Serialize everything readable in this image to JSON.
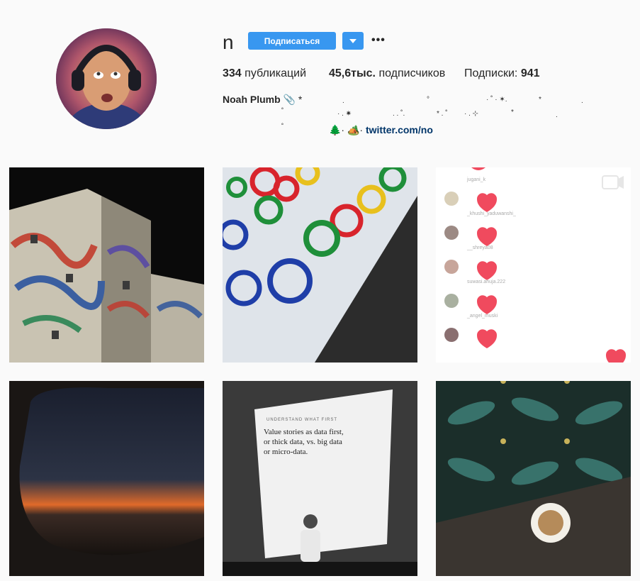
{
  "profile": {
    "username": "n",
    "follow_label": "Подписаться",
    "more_label": "•••",
    "posts_count": "334",
    "posts_label": "публикаций",
    "followers_count": "45,6тыс.",
    "followers_label": "подписчиков",
    "following_label": "Подписки:",
    "following_count": "941",
    "name": "Noah Plumb",
    "name_emoji": "📎 *",
    "bio_line1_stars": [
      ".",
      "°",
      "· ˚ · ✶.",
      "*",
      "."
    ],
    "bio_line2_stars": [
      "˚",
      "· . ✷",
      ". . ˚.",
      "* . ˚",
      "· . ⊹",
      "*",
      "."
    ],
    "bio_line3_star": "˚",
    "bio_emoji": "🌲· 🏕️·",
    "website": "twitter.com/no"
  },
  "posts": [
    {
      "name": "post-building-mural"
    },
    {
      "name": "post-paint-circles"
    },
    {
      "name": "post-live-hearts",
      "comments": [
        "jugani_k",
        "_khushi_yaduwanshi_",
        "__shreya08",
        "suwasi.ahuja.222",
        "_angel_muski"
      ]
    },
    {
      "name": "post-airplane-window"
    },
    {
      "name": "post-presentation",
      "slide_kicker": "UNDERSTAND WHAT FIRST",
      "slide_lines": [
        "Value stories as data first,",
        "or thick data, vs. big data",
        "or micro-data."
      ]
    },
    {
      "name": "post-coffee-tiles"
    }
  ]
}
